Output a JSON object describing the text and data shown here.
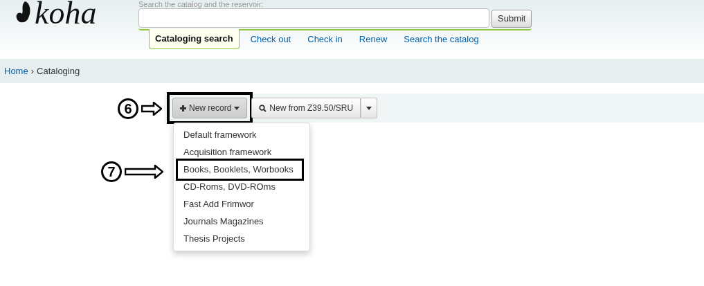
{
  "logo": {
    "text": "koha"
  },
  "search": {
    "label": "Search the catalog and the reservoir:",
    "button": "Submit"
  },
  "search_tabs": [
    {
      "label": "Cataloging search",
      "selected": true
    },
    {
      "label": "Check out",
      "selected": false
    },
    {
      "label": "Check in",
      "selected": false
    },
    {
      "label": "Renew",
      "selected": false
    },
    {
      "label": "Search the catalog",
      "selected": false
    }
  ],
  "breadcrumb": [
    {
      "label": "Home",
      "kind": "link"
    },
    {
      "label": "›",
      "kind": "separator"
    },
    {
      "label": "Cataloging",
      "kind": "current"
    }
  ],
  "toolbar": {
    "new_record": {
      "label": "New record",
      "highlighted": true,
      "expanded": true
    },
    "z3950": {
      "label": "New from Z39.50/SRU"
    }
  },
  "menu_items": [
    {
      "label": "Default framework",
      "highlighted": false
    },
    {
      "label": "Acquisition framework",
      "highlighted": false
    },
    {
      "label": "Books, Booklets, Worbooks",
      "highlighted": true
    },
    {
      "label": "CD-Roms, DVD-ROms",
      "highlighted": false
    },
    {
      "label": "Fast Add Frimwor",
      "highlighted": false
    },
    {
      "label": "Journals Magazines",
      "highlighted": false
    },
    {
      "label": "Thesis Projects",
      "highlighted": false
    }
  ],
  "callouts": [
    {
      "number": "6"
    },
    {
      "number": "7"
    }
  ]
}
